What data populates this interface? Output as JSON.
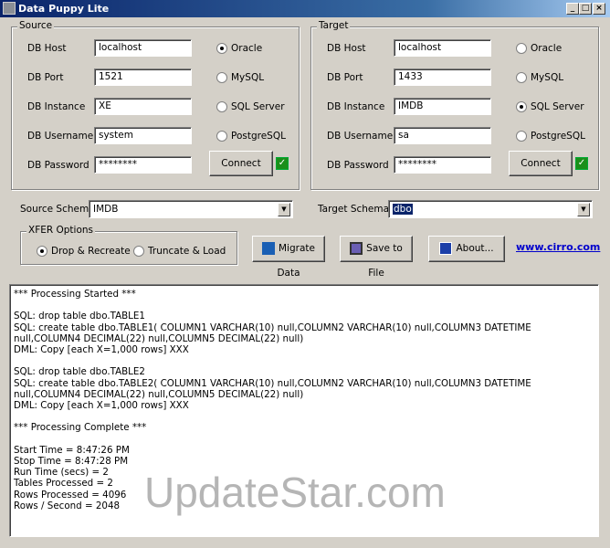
{
  "window": {
    "title": "Data Puppy Lite"
  },
  "source": {
    "title": "Source",
    "fields": [
      {
        "label": "DB Host",
        "value": "localhost"
      },
      {
        "label": "DB Port",
        "value": "1521"
      },
      {
        "label": "DB Instance",
        "value": "XE"
      },
      {
        "label": "DB Username",
        "value": "system"
      },
      {
        "label": "DB Password",
        "value": "********"
      }
    ],
    "db_types": [
      "Oracle",
      "MySQL",
      "SQL Server",
      "PostgreSQL"
    ],
    "selected_db": "Oracle",
    "connect_label": "Connect"
  },
  "target": {
    "title": "Target",
    "fields": [
      {
        "label": "DB Host",
        "value": "localhost"
      },
      {
        "label": "DB Port",
        "value": "1433"
      },
      {
        "label": "DB Instance",
        "value": "IMDB"
      },
      {
        "label": "DB Username",
        "value": "sa"
      },
      {
        "label": "DB Password",
        "value": "********"
      }
    ],
    "db_types": [
      "Oracle",
      "MySQL",
      "SQL Server",
      "PostgreSQL"
    ],
    "selected_db": "SQL Server",
    "connect_label": "Connect"
  },
  "schemas": {
    "source_label": "Source Schema",
    "source_value": "IMDB",
    "target_label": "Target Schema",
    "target_value": "dbo"
  },
  "xfer": {
    "title": "XFER Options",
    "options": [
      "Drop & Recreate",
      "Truncate & Load"
    ],
    "selected": "Drop & Recreate"
  },
  "actions": {
    "migrate": "Migrate Data",
    "save": "Save to File",
    "about": "About...",
    "link": "www.cirro.com"
  },
  "log": "*** Processing Started ***\n\nSQL: drop table dbo.TABLE1\nSQL: create table dbo.TABLE1( COLUMN1 VARCHAR(10) null,COLUMN2 VARCHAR(10) null,COLUMN3 DATETIME null,COLUMN4 DECIMAL(22) null,COLUMN5 DECIMAL(22) null)\nDML: Copy [each X=1,000 rows] XXX\n\nSQL: drop table dbo.TABLE2\nSQL: create table dbo.TABLE2( COLUMN1 VARCHAR(10) null,COLUMN2 VARCHAR(10) null,COLUMN3 DATETIME null,COLUMN4 DECIMAL(22) null,COLUMN5 DECIMAL(22) null)\nDML: Copy [each X=1,000 rows] XXX\n\n*** Processing Complete ***\n\nStart Time = 8:47:26 PM\nStop Time = 8:47:28 PM\nRun Time (secs) = 2\nTables Processed = 2\nRows Processed = 4096\nRows / Second = 2048",
  "watermark": "UpdateStar.com"
}
